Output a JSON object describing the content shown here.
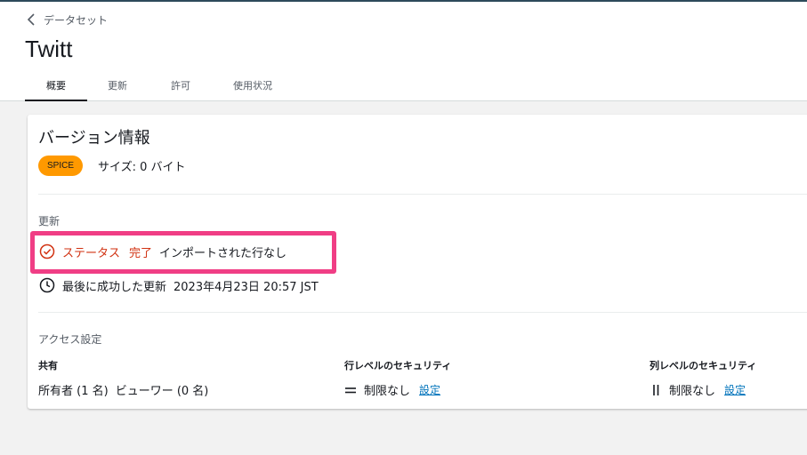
{
  "breadcrumb": {
    "back_label": "データセット"
  },
  "page": {
    "title": "Twitt"
  },
  "tabs": [
    {
      "label": "概要",
      "active": true
    },
    {
      "label": "更新",
      "active": false
    },
    {
      "label": "許可",
      "active": false
    },
    {
      "label": "使用状況",
      "active": false
    }
  ],
  "version": {
    "title": "バージョン情報",
    "badge": "SPICE",
    "size": "サイズ: 0 バイト"
  },
  "update": {
    "label": "更新",
    "status_prefix": "ステータス",
    "status_value": "完了",
    "status_detail": "インポートされた行なし",
    "last_success": "最後に成功した更新",
    "last_success_date": "2023年4月23日 20:57 JST"
  },
  "access": {
    "label": "アクセス設定",
    "sharing": {
      "header": "共有",
      "owners": "所有者 (1 名)",
      "viewers": "ビューワー (0 名)"
    },
    "row_security": {
      "header": "行レベルのセキュリティ",
      "value": "制限なし",
      "link": "設定"
    },
    "column_security": {
      "header": "列レベルのセキュリティ",
      "value": "制限なし",
      "link": "設定"
    }
  },
  "colors": {
    "accent_orange": "#ff9900",
    "status_red": "#d13212",
    "highlight_pink": "#f03e85",
    "link_blue": "#0073bb"
  },
  "icons": [
    "chevron-left-icon",
    "check-circle-icon",
    "clock-icon",
    "equals-icon",
    "pause-bars-icon"
  ]
}
